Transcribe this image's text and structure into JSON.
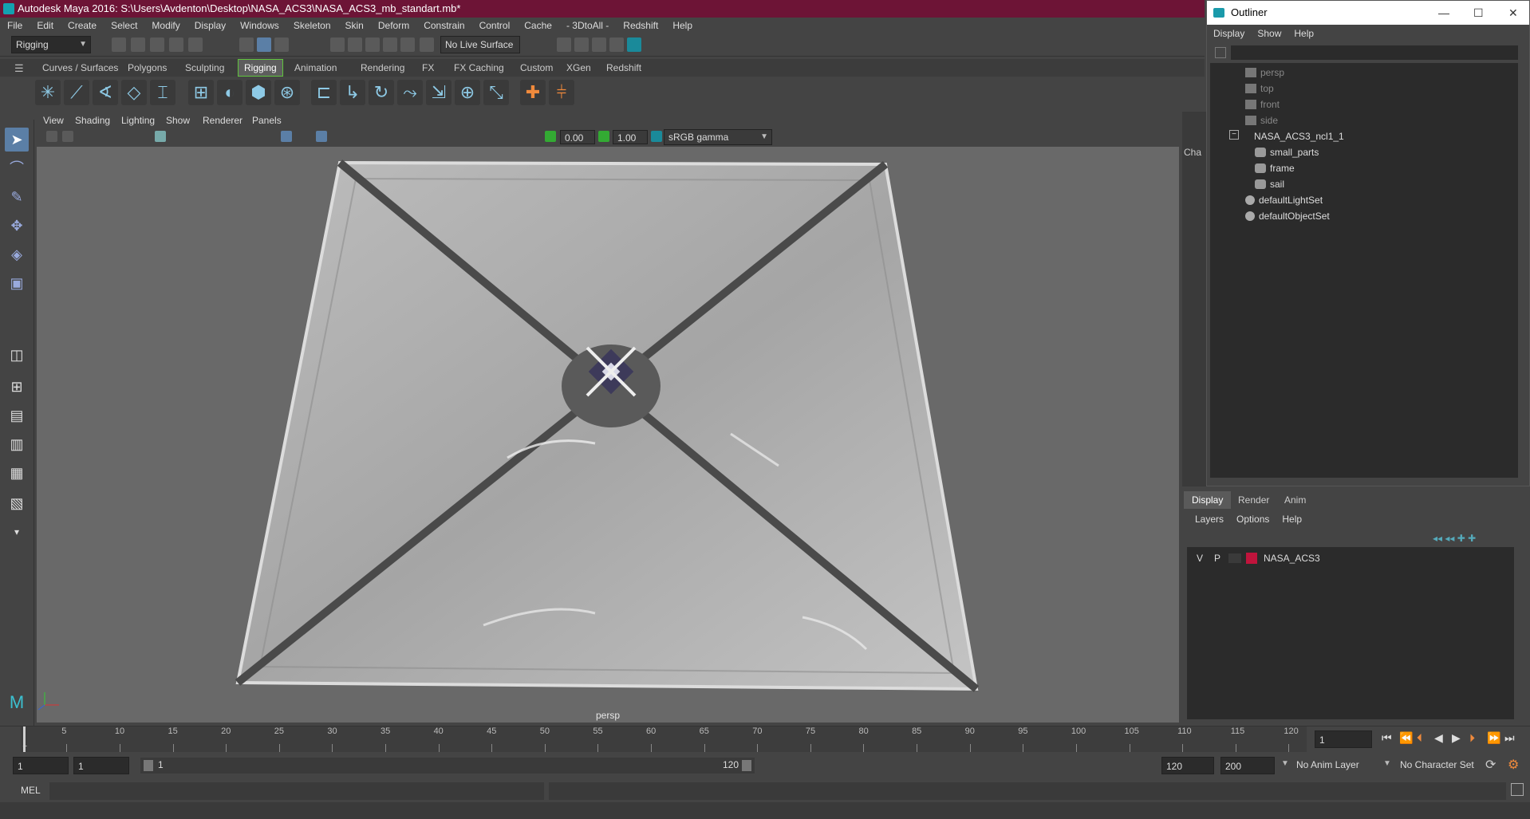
{
  "title": "Autodesk Maya 2016: S:\\Users\\Avdenton\\Desktop\\NASA_ACS3\\NASA_ACS3_mb_standart.mb*",
  "menubar": [
    "File",
    "Edit",
    "Create",
    "Select",
    "Modify",
    "Display",
    "Windows",
    "Skeleton",
    "Skin",
    "Deform",
    "Constrain",
    "Control",
    "Cache",
    "- 3DtoAll -",
    "Redshift",
    "Help"
  ],
  "status_line": {
    "menu_set": "Rigging",
    "live_surface": "No Live Surface"
  },
  "shelf_tabs": [
    "Curves / Surfaces",
    "Polygons",
    "Sculpting",
    "Rigging",
    "Animation",
    "Rendering",
    "FX",
    "FX Caching",
    "Custom",
    "XGen",
    "Redshift"
  ],
  "shelf_active": "Rigging",
  "viewport": {
    "menu": [
      "View",
      "Shading",
      "Lighting",
      "Show",
      "Renderer",
      "Panels"
    ],
    "exposure": "0.00",
    "gamma": "1.00",
    "color_space": "sRGB gamma",
    "camera_label": "persp"
  },
  "outliner": {
    "title": "Outliner",
    "menu": [
      "Display",
      "Show",
      "Help"
    ],
    "items": [
      {
        "label": "persp",
        "dim": true
      },
      {
        "label": "top",
        "dim": true
      },
      {
        "label": "front",
        "dim": true
      },
      {
        "label": "side",
        "dim": true
      },
      {
        "label": "NASA_ACS3_ncl1_1",
        "dim": false
      },
      {
        "label": "small_parts",
        "dim": false
      },
      {
        "label": "frame",
        "dim": false
      },
      {
        "label": "sail",
        "dim": false
      },
      {
        "label": "defaultLightSet",
        "dim": false
      },
      {
        "label": "defaultObjectSet",
        "dim": false
      }
    ]
  },
  "channel_box_tab": "Cha",
  "layer_editor": {
    "tabs": [
      "Display",
      "Render",
      "Anim"
    ],
    "menu": [
      "Layers",
      "Options",
      "Help"
    ],
    "layer": {
      "v": "V",
      "p": "P",
      "name": "NASA_ACS3",
      "color": "#c0143c"
    }
  },
  "timeslider": {
    "ticks": [
      5,
      10,
      15,
      20,
      25,
      30,
      35,
      40,
      45,
      50,
      55,
      60,
      65,
      70,
      75,
      80,
      85,
      90,
      95,
      100,
      105,
      110,
      115,
      120
    ],
    "first": "1",
    "current_frame": "1"
  },
  "range": {
    "start": "1",
    "playback_start": "1",
    "range_start": "1",
    "range_end": "120",
    "playback_end": "120",
    "end": "200",
    "anim_layer": "No Anim Layer",
    "character_set": "No Character Set"
  },
  "cmdline": {
    "label": "MEL"
  }
}
